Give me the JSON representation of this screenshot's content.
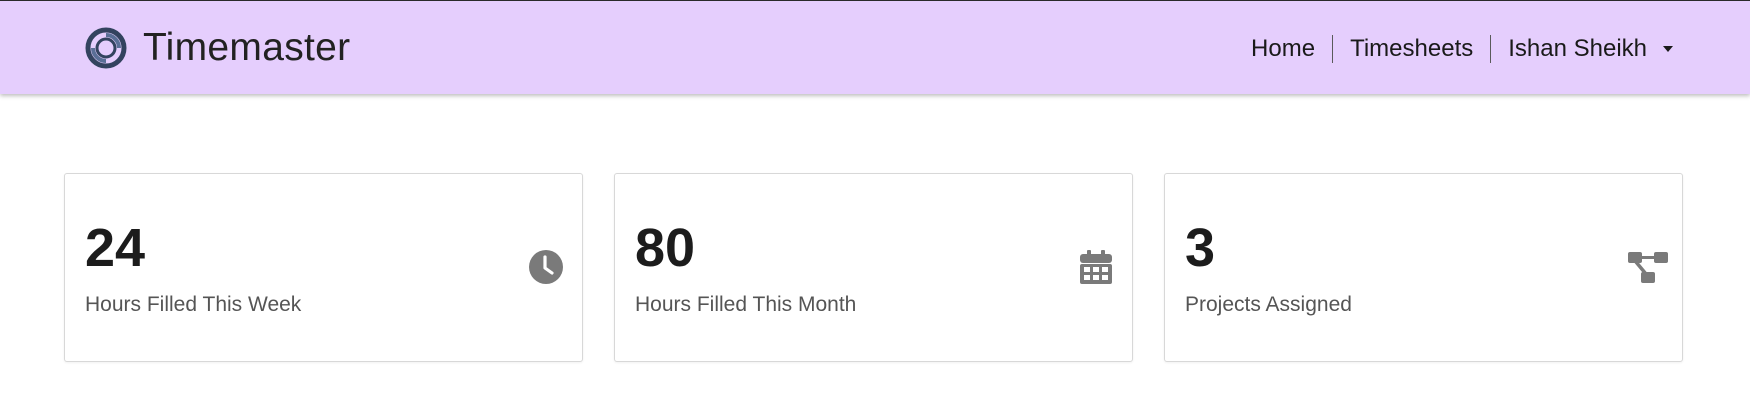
{
  "brand": {
    "name": "Timemaster",
    "logo_icon": "ring-logo-icon",
    "logo_color": "#33435f"
  },
  "navbar": {
    "background": "#e5cefd",
    "links": [
      {
        "label": "Home"
      },
      {
        "label": "Timesheets"
      }
    ],
    "user": {
      "name": "Ishan Sheikh",
      "dropdown_icon": "caret-down-icon"
    }
  },
  "stats": [
    {
      "value": "24",
      "label": "Hours Filled This Week",
      "icon": "clock-icon"
    },
    {
      "value": "80",
      "label": "Hours Filled This Month",
      "icon": "calendar-icon"
    },
    {
      "value": "3",
      "label": "Projects Assigned",
      "icon": "project-diagram-icon"
    }
  ],
  "icon_color": "#7a7a7a"
}
